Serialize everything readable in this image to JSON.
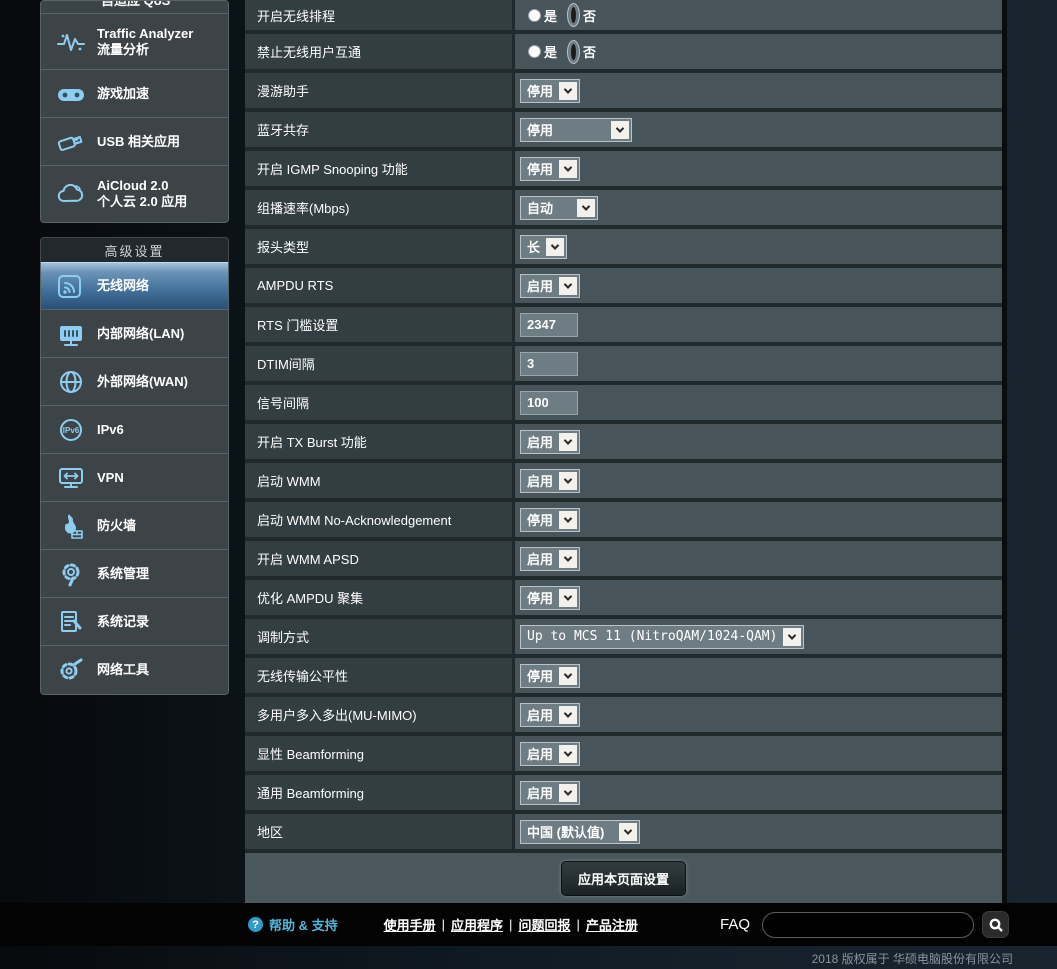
{
  "colors": {
    "accent_icon": "#8ecdf0",
    "selected_item_top": "#a3c2d8",
    "selected_item_bottom": "#2b4f75",
    "row_label_bg": "#333e42",
    "row_value_bg": "#47555b",
    "panel_bg": "#4a585e",
    "footer_bg": "#030303",
    "help_accent": "#54b7d8"
  },
  "sidebar": {
    "clipped_item": {
      "label": "自适应 QoS"
    },
    "general_items": [
      {
        "label": "Traffic Analyzer",
        "sublabel": "流量分析",
        "icon": "traffic-analyzer-icon"
      },
      {
        "label": "游戏加速",
        "sublabel": "",
        "icon": "game-boost-icon"
      },
      {
        "label": "USB 相关应用",
        "sublabel": "",
        "icon": "usb-icon"
      },
      {
        "label": "AiCloud 2.0",
        "sublabel": "个人云 2.0 应用",
        "icon": "aicloud-icon"
      }
    ],
    "advanced_header": "高级设置",
    "advanced_items": [
      {
        "label": "无线网络",
        "icon": "wireless-icon",
        "selected": true
      },
      {
        "label": "内部网络(LAN)",
        "icon": "lan-icon",
        "selected": false
      },
      {
        "label": "外部网络(WAN)",
        "icon": "wan-icon",
        "selected": false
      },
      {
        "label": "IPv6",
        "icon": "ipv6-icon",
        "selected": false
      },
      {
        "label": "VPN",
        "icon": "vpn-icon",
        "selected": false
      },
      {
        "label": "防火墙",
        "icon": "firewall-icon",
        "selected": false
      },
      {
        "label": "系统管理",
        "icon": "system-admin-icon",
        "selected": false
      },
      {
        "label": "系统记录",
        "icon": "system-log-icon",
        "selected": false
      },
      {
        "label": "网络工具",
        "icon": "network-tools-icon",
        "selected": false
      }
    ]
  },
  "form": {
    "rows": [
      {
        "label": "开启无线排程",
        "type": "radio",
        "options": [
          "是",
          "否"
        ],
        "selected": "否"
      },
      {
        "label": "禁止无线用户互通",
        "type": "radio",
        "options": [
          "是",
          "否"
        ],
        "selected": "否"
      },
      {
        "label": "漫游助手",
        "type": "select",
        "value": "停用"
      },
      {
        "label": "蓝牙共存",
        "type": "select",
        "value": "停用"
      },
      {
        "label": "开启 IGMP Snooping 功能",
        "type": "select",
        "value": "停用"
      },
      {
        "label": "组播速率(Mbps)",
        "type": "select",
        "value": "自动"
      },
      {
        "label": "报头类型",
        "type": "select",
        "value": "长"
      },
      {
        "label": "AMPDU RTS",
        "type": "select",
        "value": "启用"
      },
      {
        "label": "RTS 门槛设置",
        "type": "input",
        "value": "2347"
      },
      {
        "label": "DTIM间隔",
        "type": "input",
        "value": "3"
      },
      {
        "label": "信号间隔",
        "type": "input",
        "value": "100"
      },
      {
        "label": "开启 TX Burst 功能",
        "type": "select",
        "value": "启用"
      },
      {
        "label": "启动 WMM",
        "type": "select",
        "value": "启用"
      },
      {
        "label": "启动 WMM No-Acknowledgement",
        "type": "select",
        "value": "停用"
      },
      {
        "label": "开启 WMM APSD",
        "type": "select",
        "value": "启用"
      },
      {
        "label": "优化 AMPDU 聚集",
        "type": "select",
        "value": "停用"
      },
      {
        "label": "调制方式",
        "type": "select",
        "value": "Up to MCS 11 (NitroQAM/1024-QAM)"
      },
      {
        "label": "无线传输公平性",
        "type": "select",
        "value": "停用"
      },
      {
        "label": "多用户多入多出(MU-MIMO)",
        "type": "select",
        "value": "启用"
      },
      {
        "label": "显性 Beamforming",
        "type": "select",
        "value": "启用"
      },
      {
        "label": "通用 Beamforming",
        "type": "select",
        "value": "启用"
      },
      {
        "label": "地区",
        "type": "select",
        "value": "中国 (默认值)"
      }
    ],
    "apply_button": "应用本页面设置"
  },
  "footer": {
    "help_icon": "question-mark-icon",
    "help_label": "帮助 & 支持",
    "links": [
      "使用手册",
      "应用程序",
      "问题回报",
      "产品注册"
    ],
    "separator": "|",
    "faq_label": "FAQ",
    "search_value": "",
    "search_icon": "magnifier-icon"
  },
  "copyright": "2018 版权属于 华硕电脑股份有限公司"
}
